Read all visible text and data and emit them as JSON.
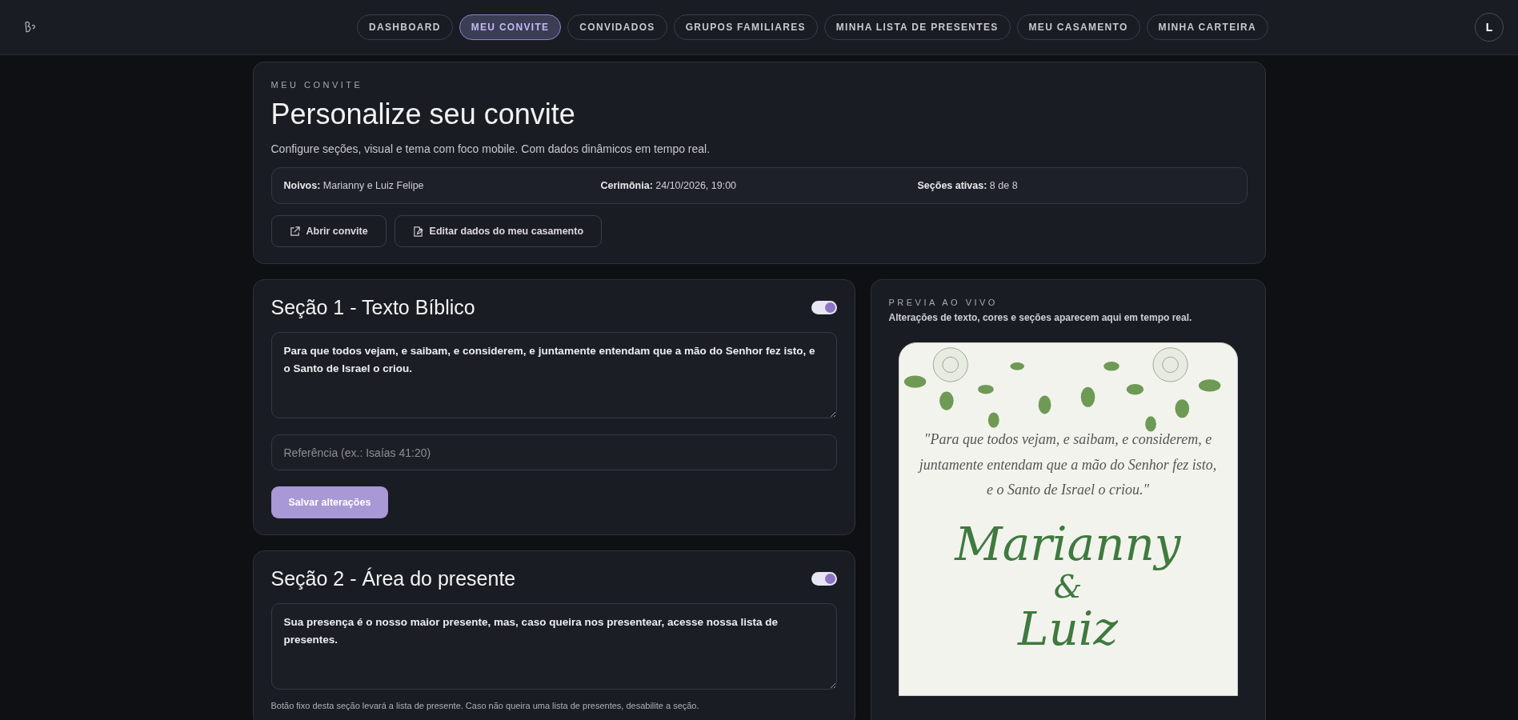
{
  "nav": {
    "items": [
      {
        "label": "DASHBOARD",
        "selected": false
      },
      {
        "label": "MEU CONVITE",
        "selected": true
      },
      {
        "label": "CONVIDADOS",
        "selected": false
      },
      {
        "label": "GRUPOS FAMILIARES",
        "selected": false
      },
      {
        "label": "MINHA LISTA DE PRESENTES",
        "selected": false
      },
      {
        "label": "MEU CASAMENTO",
        "selected": false
      },
      {
        "label": "MINHA CARTEIRA",
        "selected": false
      }
    ],
    "avatar": "L"
  },
  "header": {
    "eyebrow": "MEU CONVITE",
    "title": "Personalize seu convite",
    "subtitle": "Configure seções, visual e tema com foco mobile. Com dados dinâmicos em tempo real.",
    "facts": [
      {
        "label": "Noivos:",
        "value": "Marianny e Luiz Felipe"
      },
      {
        "label": "Cerimônia:",
        "value": "24/10/2026, 19:00"
      },
      {
        "label": "Seções ativas:",
        "value": "8 de 8"
      }
    ],
    "actions": [
      {
        "kind": "external",
        "label": "Abrir convite"
      },
      {
        "kind": "edit",
        "label": "Editar dados do meu casamento"
      }
    ]
  },
  "sections": [
    {
      "title": "Seção 1 - Texto Bíblico",
      "enabled": true,
      "text": "Para que todos vejam, e saibam, e considerem, e juntamente entendam que a mão do Senhor fez isto, e o Santo de Israel o criou.",
      "reference_placeholder": "Referência (ex.: Isaías 41:20)",
      "save_button": "Salvar alterações"
    },
    {
      "title": "Seção 2 - Área do presente",
      "enabled": true,
      "text": "Sua presença é o nosso maior presente, mas, caso queira nos presentear, acesse nossa lista de presentes.",
      "note": "Botão fixo desta seção levará a lista de presente. Caso não queira uma lista de presentes, desabilite a seção."
    }
  ],
  "preview": {
    "eyebrow": "PREVIA AO VIVO",
    "subtitle": "Alterações de texto, cores e seções aparecem aqui em tempo real.",
    "invite": {
      "quote": "\"Para que todos vejam, e saibam, e considerem, e juntamente entendam que a mão do Senhor fez isto, e o Santo de Israel o criou.\"",
      "name_1": "Marianny",
      "ampersand": "&",
      "name_2": "Luiz"
    }
  }
}
